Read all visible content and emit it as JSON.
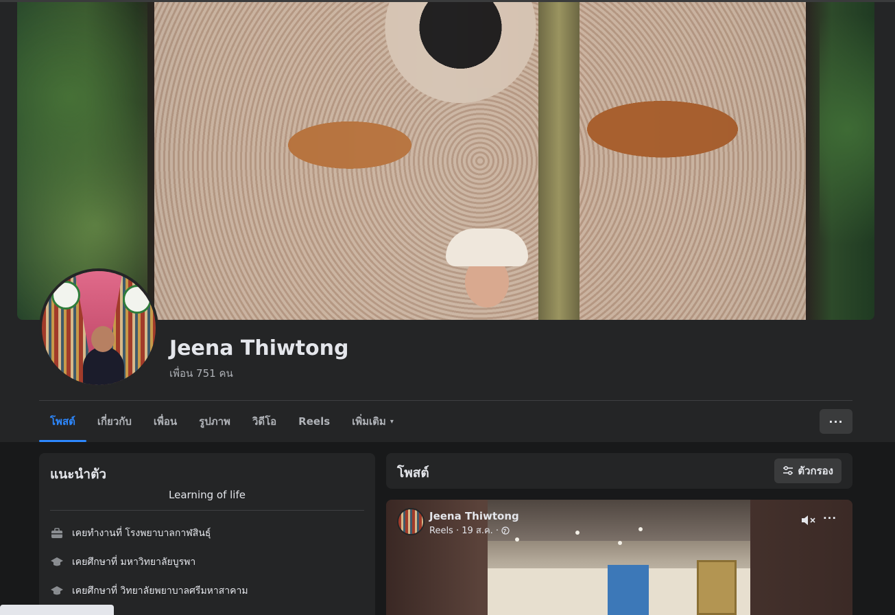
{
  "profile": {
    "name": "Jeena Thiwtong",
    "friends": "เพื่อน 751 คน"
  },
  "tabs": [
    {
      "label": "โพสต์",
      "active": true
    },
    {
      "label": "เกี่ยวกับ"
    },
    {
      "label": "เพื่อน"
    },
    {
      "label": "รูปภาพ"
    },
    {
      "label": "วิดีโอ"
    },
    {
      "label": "Reels"
    },
    {
      "label": "เพิ่มเติม",
      "caret": "▾"
    }
  ],
  "more_button": "···",
  "intro": {
    "title": "แนะนำตัว",
    "bio": "Learning of life",
    "items": [
      {
        "icon": "briefcase-icon",
        "text": "เคยทำงานที่ โรงพยาบาลกาฬสินธุ์"
      },
      {
        "icon": "graduation-cap-icon",
        "text": "เคยศึกษาที่ มหาวิทยาลัยบูรพา"
      },
      {
        "icon": "graduation-cap-icon",
        "text": "เคยศึกษาที่ วิทยาลัยพยาบาลศรีมหาสาคาม"
      }
    ]
  },
  "posts": {
    "title": "โพสต์",
    "filter_label": "ตัวกรอง"
  },
  "post": {
    "author": "Jeena Thiwtong",
    "meta": "Reels · 19 ส.ค. ·",
    "more": "···"
  },
  "colors": {
    "accent": "#2d88ff",
    "surface": "#242526",
    "background": "#18191a",
    "text": "#e4e6eb",
    "secondary_text": "#b0b3b8"
  }
}
